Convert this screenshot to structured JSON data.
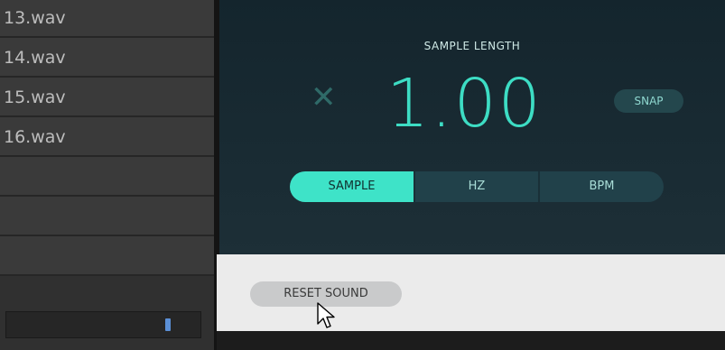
{
  "file_list": {
    "items": [
      "13.wav",
      "14.wav",
      "15.wav",
      "16.wav",
      "",
      "",
      ""
    ]
  },
  "sample_length": {
    "label": "SAMPLE LENGTH",
    "multiplier_icon": "multiply-icon",
    "value": "1.00",
    "snap_label": "SNAP"
  },
  "mode_toggle": {
    "options": [
      "SAMPLE",
      "HZ",
      "BPM"
    ],
    "selected": "SAMPLE"
  },
  "reset_button": {
    "label": "RESET SOUND"
  },
  "colors": {
    "accent": "#3ee3c8",
    "panel_bg": "#192b33",
    "light_panel_bg": "#ebebeb"
  },
  "cursor": {
    "icon": "mouse-pointer-icon"
  }
}
